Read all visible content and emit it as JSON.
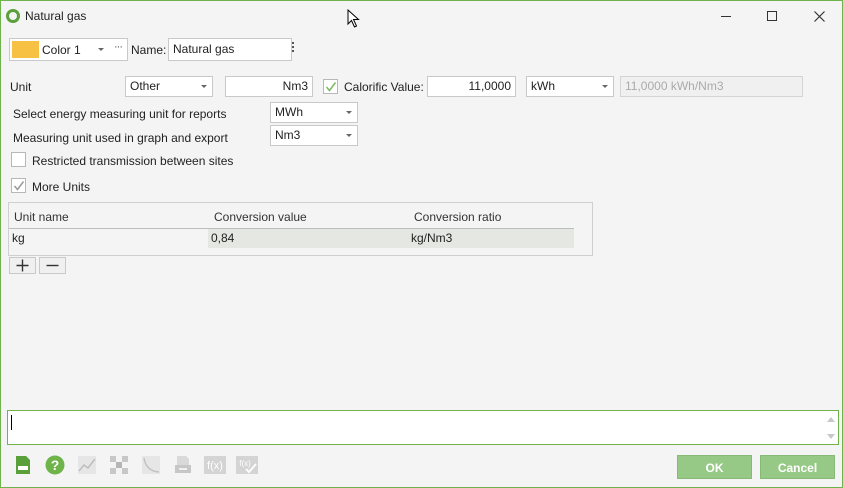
{
  "window": {
    "title": "Natural gas"
  },
  "header": {
    "color_label": "Color 1",
    "color_more": "···",
    "color_swatch": "#f7c244",
    "name_label": "Name:",
    "name_value": "Natural gas"
  },
  "unit_row": {
    "label": "Unit",
    "unit_select": "Other",
    "unit_value": "Nm3",
    "calorific_checked": true,
    "calorific_label": "Calorific Value:",
    "calorific_value": "11,0000",
    "calorific_unit": "kWh",
    "calorific_result": "11,0000 kWh/Nm3"
  },
  "reports": {
    "energy_label": "Select energy measuring unit for reports",
    "energy_value": "MWh",
    "graph_label": "Measuring unit used in graph and export",
    "graph_value": "Nm3"
  },
  "options": {
    "restricted_label": "Restricted transmission between sites",
    "restricted_checked": false,
    "more_units_label": "More Units",
    "more_units_checked": true
  },
  "units_table": {
    "headers": [
      "Unit name",
      "Conversion value",
      "Conversion ratio"
    ],
    "rows": [
      {
        "name": "kg",
        "value": "0,84",
        "ratio": "kg/Nm3"
      }
    ]
  },
  "toolbar": {
    "icons": [
      "document-icon",
      "help-icon",
      "chart-icon",
      "grid-icon",
      "curve-icon",
      "print-icon",
      "formula-icon",
      "formula-check-icon"
    ]
  },
  "footer": {
    "ok_label": "OK",
    "cancel_label": "Cancel"
  },
  "colors": {
    "accent": "#6fb34b",
    "button": "#97c986"
  }
}
